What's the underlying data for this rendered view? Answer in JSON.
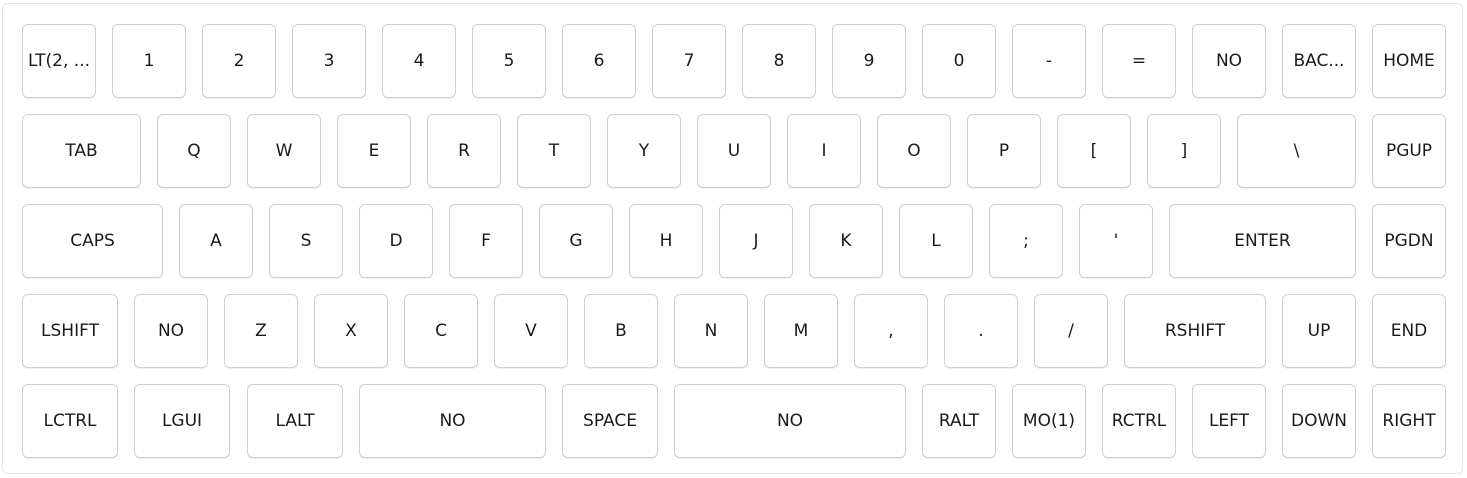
{
  "keyboard": {
    "rows": [
      {
        "keys": [
          {
            "label": "LT(2, ..."
          },
          {
            "label": "1"
          },
          {
            "label": "2"
          },
          {
            "label": "3"
          },
          {
            "label": "4"
          },
          {
            "label": "5"
          },
          {
            "label": "6"
          },
          {
            "label": "7"
          },
          {
            "label": "8"
          },
          {
            "label": "9"
          },
          {
            "label": "0"
          },
          {
            "label": "-"
          },
          {
            "label": "="
          },
          {
            "label": "NO"
          },
          {
            "label": "BAC..."
          },
          {
            "label": "HOME"
          }
        ]
      },
      {
        "keys": [
          {
            "label": "TAB"
          },
          {
            "label": "Q"
          },
          {
            "label": "W"
          },
          {
            "label": "E"
          },
          {
            "label": "R"
          },
          {
            "label": "T"
          },
          {
            "label": "Y"
          },
          {
            "label": "U"
          },
          {
            "label": "I"
          },
          {
            "label": "O"
          },
          {
            "label": "P"
          },
          {
            "label": "["
          },
          {
            "label": "]"
          },
          {
            "label": "\\"
          },
          {
            "label": "PGUP"
          }
        ]
      },
      {
        "keys": [
          {
            "label": "CAPS"
          },
          {
            "label": "A"
          },
          {
            "label": "S"
          },
          {
            "label": "D"
          },
          {
            "label": "F"
          },
          {
            "label": "G"
          },
          {
            "label": "H"
          },
          {
            "label": "J"
          },
          {
            "label": "K"
          },
          {
            "label": "L"
          },
          {
            "label": ";"
          },
          {
            "label": "'"
          },
          {
            "label": "ENTER"
          },
          {
            "label": "PGDN"
          }
        ]
      },
      {
        "keys": [
          {
            "label": "LSHIFT"
          },
          {
            "label": "NO"
          },
          {
            "label": "Z"
          },
          {
            "label": "X"
          },
          {
            "label": "C"
          },
          {
            "label": "V"
          },
          {
            "label": "B"
          },
          {
            "label": "N"
          },
          {
            "label": "M"
          },
          {
            "label": ","
          },
          {
            "label": "."
          },
          {
            "label": "/"
          },
          {
            "label": "RSHIFT"
          },
          {
            "label": "UP"
          },
          {
            "label": "END"
          }
        ]
      },
      {
        "keys": [
          {
            "label": "LCTRL"
          },
          {
            "label": "LGUI"
          },
          {
            "label": "LALT"
          },
          {
            "label": "NO"
          },
          {
            "label": "SPACE"
          },
          {
            "label": "NO"
          },
          {
            "label": "RALT"
          },
          {
            "label": "MO(1)"
          },
          {
            "label": "RCTRL"
          },
          {
            "label": "LEFT"
          },
          {
            "label": "DOWN"
          },
          {
            "label": "RIGHT"
          }
        ]
      }
    ]
  }
}
